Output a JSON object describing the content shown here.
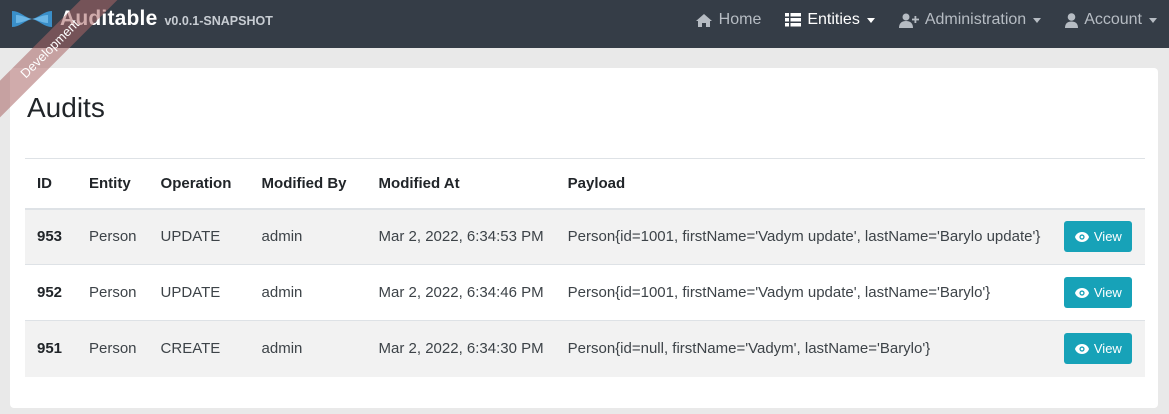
{
  "navbar": {
    "brand_title": "Auditable",
    "brand_version": "v0.0.1-SNAPSHOT",
    "ribbon": "Development",
    "items": [
      {
        "label": "Home",
        "icon": "home-icon"
      },
      {
        "label": "Entities",
        "icon": "table-list-icon",
        "active": true
      },
      {
        "label": "Administration",
        "icon": "user-plus-icon"
      },
      {
        "label": "Account",
        "icon": "user-icon"
      }
    ]
  },
  "page": {
    "title": "Audits"
  },
  "table": {
    "columns": [
      "ID",
      "Entity",
      "Operation",
      "Modified By",
      "Modified At",
      "Payload",
      ""
    ],
    "rows": [
      {
        "id": "953",
        "entity": "Person",
        "operation": "UPDATE",
        "modified_by": "admin",
        "modified_at": "Mar 2, 2022, 6:34:53 PM",
        "payload": "Person{id=1001, firstName='Vadym update', lastName='Barylo update'}",
        "action": "View"
      },
      {
        "id": "952",
        "entity": "Person",
        "operation": "UPDATE",
        "modified_by": "admin",
        "modified_at": "Mar 2, 2022, 6:34:46 PM",
        "payload": "Person{id=1001, firstName='Vadym update', lastName='Barylo'}",
        "action": "View"
      },
      {
        "id": "951",
        "entity": "Person",
        "operation": "CREATE",
        "modified_by": "admin",
        "modified_at": "Mar 2, 2022, 6:34:30 PM",
        "payload": "Person{id=null, firstName='Vadym', lastName='Barylo'}",
        "action": "View"
      }
    ]
  },
  "colors": {
    "navbar_bg": "#353d47",
    "view_button": "#17a2b8",
    "ribbon": "#aa6666"
  }
}
